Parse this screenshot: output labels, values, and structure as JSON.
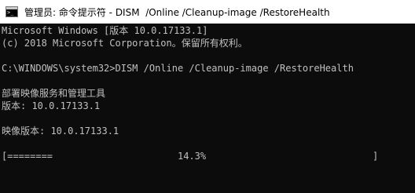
{
  "window": {
    "title": "管理员: 命令提示符 - DISM  /Online /Cleanup-image /RestoreHealth",
    "icon": "console-icon",
    "icon_glyph": ">_"
  },
  "console": {
    "lines": [
      "Microsoft Windows [版本 10.0.17133.1]",
      "(c) 2018 Microsoft Corporation。保留所有权利。",
      "",
      "C:\\WINDOWS\\system32>DISM /Online /Cleanup-image /RestoreHealth",
      "",
      "部署映像服务和管理工具",
      "版本: 10.0.17133.1",
      "",
      "映像版本: 10.0.17133.1",
      ""
    ],
    "progress": {
      "bar_text": "[========",
      "percent_text": "14.3%",
      "percent_value": 14.3,
      "bar_end": "]"
    }
  },
  "colors": {
    "console_background": "#0c0c0c",
    "console_text": "#c0c0c0",
    "titlebar_background": "#ffffff"
  }
}
